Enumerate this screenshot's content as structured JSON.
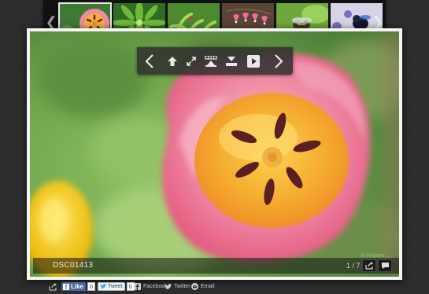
{
  "thumbnails": [
    {
      "icon": "tulip-thumb",
      "active": true
    },
    {
      "icon": "leaf-rosette-thumb",
      "active": false
    },
    {
      "icon": "succulent-thumb",
      "active": false
    },
    {
      "icon": "bleeding-heart-thumb",
      "active": false
    },
    {
      "icon": "bee-thumb",
      "active": false
    },
    {
      "icon": "bumblebee-thumb",
      "active": false
    }
  ],
  "strip": {
    "prev_glyph": "❮",
    "next_glyph": "❯"
  },
  "controls": [
    "previous-icon",
    "upload-icon",
    "fullscreen-icon",
    "toggle-thumbnails-icon",
    "download-icon",
    "play-slideshow-icon",
    "next-icon"
  ],
  "caption": {
    "title": "DSC01413",
    "counter": "1 / 7",
    "watermark": "© Vincent..."
  },
  "share": {
    "like_label": "Like",
    "like_count": "0",
    "tweet_label": "Tweet",
    "tweet_count": "0",
    "facebook_label": "Facebook",
    "twitter_label": "Twitter",
    "email_label": "Email"
  },
  "colors": {
    "accent": "#4a66a0",
    "tulip_pink": "#ef7f9a",
    "tulip_yellow": "#f7b21a"
  }
}
